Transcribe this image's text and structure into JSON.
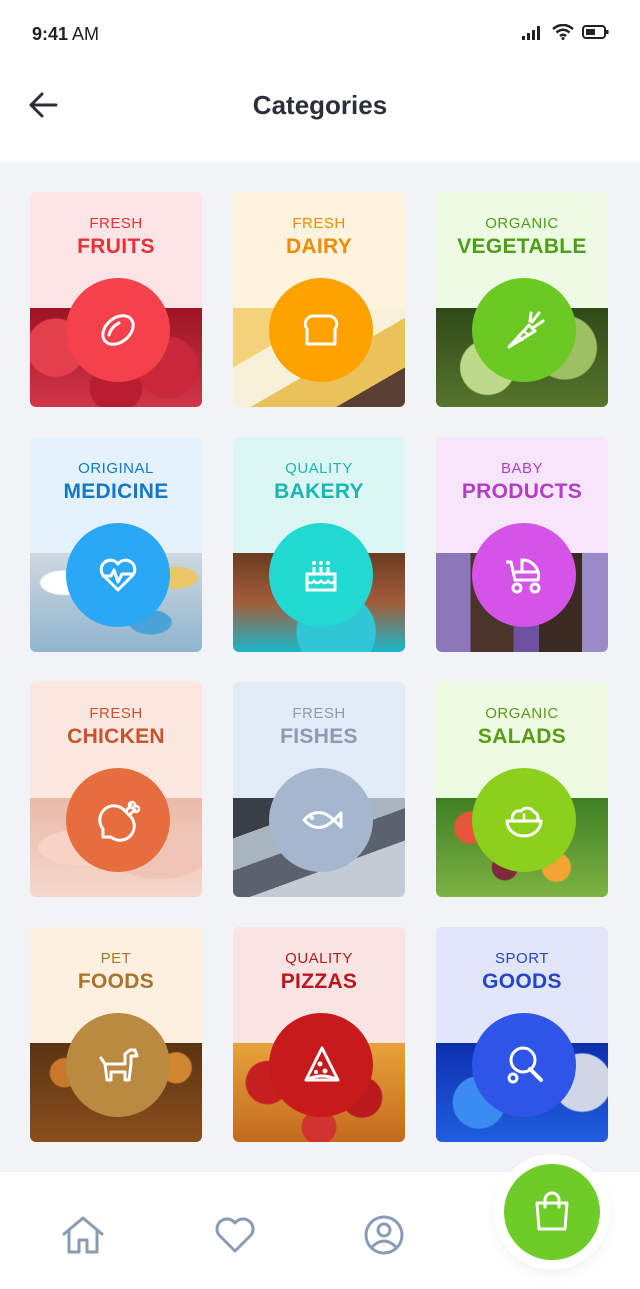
{
  "status_bar": {
    "time_bold": "9:41",
    "time_suffix": "AM"
  },
  "header": {
    "title": "Categories"
  },
  "categories": [
    {
      "sub": "FRESH",
      "title": "FRUITS",
      "icon": "lemon-icon",
      "text_color": "#e53238",
      "bg": "#fde4e6",
      "circle": "#f3424b"
    },
    {
      "sub": "FRESH",
      "title": "DAIRY",
      "icon": "bread-icon",
      "text_color": "#f08a00",
      "bg": "#fdf3de",
      "circle": "#ffa200"
    },
    {
      "sub": "ORGANIC",
      "title": "VEGETABLE",
      "icon": "carrot-icon",
      "text_color": "#4e9e14",
      "bg": "#eefbe4",
      "circle": "#6cc924"
    },
    {
      "sub": "ORIGINAL",
      "title": "MEDICINE",
      "icon": "heartbeat-icon",
      "text_color": "#1577c9",
      "bg": "#e3f2fd",
      "circle": "#2aa7f5"
    },
    {
      "sub": "QUALITY",
      "title": "BAKERY",
      "icon": "cake-icon",
      "text_color": "#1ab7b2",
      "bg": "#dcf6f4",
      "circle": "#22d9d2"
    },
    {
      "sub": "BABY",
      "title": "PRODUCTS",
      "icon": "stroller-icon",
      "text_color": "#b33ec4",
      "bg": "#f7e6fb",
      "circle": "#d553e6"
    },
    {
      "sub": "FRESH",
      "title": "CHICKEN",
      "icon": "chicken-leg-icon",
      "text_color": "#c6542c",
      "bg": "#fbe7e0",
      "circle": "#e86d3e"
    },
    {
      "sub": "FRESH",
      "title": "FISHES",
      "icon": "fish-icon",
      "text_color": "#8a9ab0",
      "bg": "#e2ecf8",
      "circle": "#a5b7cf"
    },
    {
      "sub": "ORGANIC",
      "title": "SALADS",
      "icon": "salad-bowl-icon",
      "text_color": "#5a9b15",
      "bg": "#eefbe3",
      "circle": "#8ccf1c"
    },
    {
      "sub": "PET",
      "title": "FOODS",
      "icon": "dog-icon",
      "text_color": "#a8742e",
      "bg": "#fdf0de",
      "circle": "#b98a40"
    },
    {
      "sub": "QUALITY",
      "title": "PIZZAS",
      "icon": "pizza-icon",
      "text_color": "#b8191c",
      "bg": "#f9e3e3",
      "circle": "#c71b1b"
    },
    {
      "sub": "SPORT",
      "title": "GOODS",
      "icon": "ping-pong-icon",
      "text_color": "#2446c9",
      "bg": "#e3e6f9",
      "circle": "#2e55e8"
    }
  ],
  "bottom_nav": {
    "items": [
      {
        "name": "home",
        "icon": "home-icon"
      },
      {
        "name": "favorites",
        "icon": "heart-icon"
      },
      {
        "name": "profile",
        "icon": "user-icon"
      }
    ],
    "cart_icon": "shopping-bag-icon",
    "cart_color": "#6fcb27"
  }
}
